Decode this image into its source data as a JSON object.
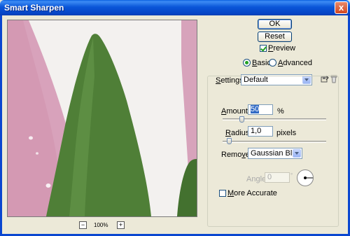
{
  "window": {
    "title": "Smart Sharpen",
    "close_glyph": "x"
  },
  "preview": {
    "zoom": "100%",
    "zoom_out_glyph": "−",
    "zoom_in_glyph": "+"
  },
  "buttons": {
    "ok": "OK",
    "reset": "Reset"
  },
  "preview_checkbox": {
    "label_u": "P",
    "label_rest": "review",
    "checked": true
  },
  "mode": {
    "basic": {
      "label_u": "B",
      "label_rest": "asic",
      "selected": true
    },
    "advanced": {
      "label_u": "A",
      "label_rest": "dvanced",
      "selected": false
    }
  },
  "settings": {
    "label_u": "S",
    "label_rest": "ettings:",
    "value": "Default"
  },
  "amount": {
    "label_u": "A",
    "label_rest": "mount:",
    "value": "50",
    "unit": "%",
    "slider_fraction": 0.18
  },
  "radius": {
    "label_u": "R",
    "label_rest": "adius:",
    "value": "1,0",
    "unit": "pixels",
    "slider_fraction": 0.06
  },
  "remove": {
    "label_pre": "Remo",
    "label_u": "v",
    "label_post": "e:",
    "value": "Gaussian Blur"
  },
  "angle": {
    "label": "Angle:",
    "value": "0",
    "disabled": true
  },
  "more_accurate": {
    "label_u": "M",
    "label_rest": "ore Accurate",
    "checked": false
  },
  "icons": [
    "save-settings-icon",
    "delete-settings-icon",
    "angle-dial-icon"
  ],
  "colors": {
    "title_bar": "#0a56d8",
    "leaf_green": "#4f8038",
    "petal_pink": "#d59bb3",
    "dialog_bg": "#ece9d8"
  }
}
